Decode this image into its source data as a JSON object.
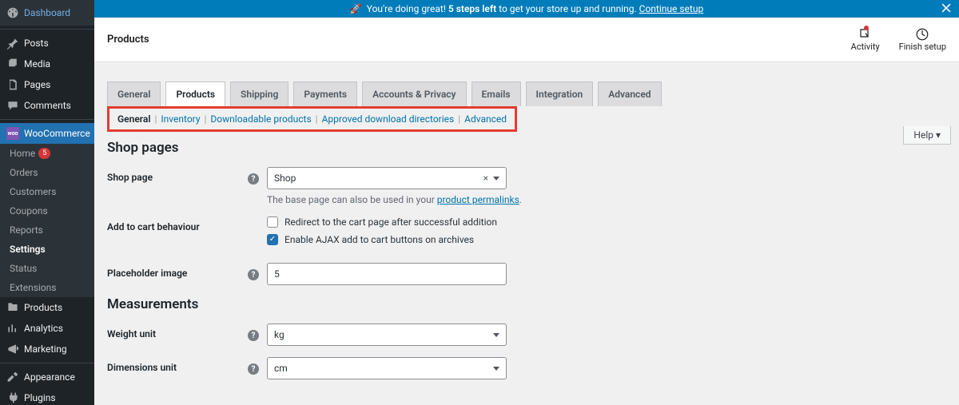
{
  "banner": {
    "rocket": "🚀",
    "prefix": "You're doing great!",
    "bold": "5 steps left",
    "suffix": "to get your store up and running.",
    "link": "Continue setup"
  },
  "sidebar": {
    "dashboard": "Dashboard",
    "posts": "Posts",
    "media": "Media",
    "pages": "Pages",
    "comments": "Comments",
    "woocommerce": "WooCommerce",
    "woo_sub": {
      "home": "Home",
      "home_badge": "5",
      "orders": "Orders",
      "customers": "Customers",
      "coupons": "Coupons",
      "reports": "Reports",
      "settings": "Settings",
      "status": "Status",
      "extensions": "Extensions"
    },
    "products": "Products",
    "analytics": "Analytics",
    "marketing": "Marketing",
    "appearance": "Appearance",
    "plugins": "Plugins"
  },
  "header": {
    "title": "Products",
    "activity": "Activity",
    "finish": "Finish setup"
  },
  "help_tab": "Help ▾",
  "tabs": {
    "general": "General",
    "products": "Products",
    "shipping": "Shipping",
    "payments": "Payments",
    "accounts": "Accounts & Privacy",
    "emails": "Emails",
    "integration": "Integration",
    "advanced": "Advanced"
  },
  "sublinks": {
    "general": "General",
    "inventory": "Inventory",
    "downloadable": "Downloadable products",
    "approved": "Approved download directories",
    "advanced": "Advanced"
  },
  "sections": {
    "shop_pages": "Shop pages",
    "measurements": "Measurements"
  },
  "form": {
    "shop_page_label": "Shop page",
    "shop_page_value": "Shop",
    "shop_page_desc_prefix": "The base page can also be used in your ",
    "shop_page_desc_link": "product permalinks",
    "add_to_cart_label": "Add to cart behaviour",
    "redirect_text": "Redirect to the cart page after successful addition",
    "ajax_text": "Enable AJAX add to cart buttons on archives",
    "placeholder_label": "Placeholder image",
    "placeholder_value": "5",
    "weight_label": "Weight unit",
    "weight_value": "kg",
    "dimensions_label": "Dimensions unit",
    "dimensions_value": "cm"
  }
}
